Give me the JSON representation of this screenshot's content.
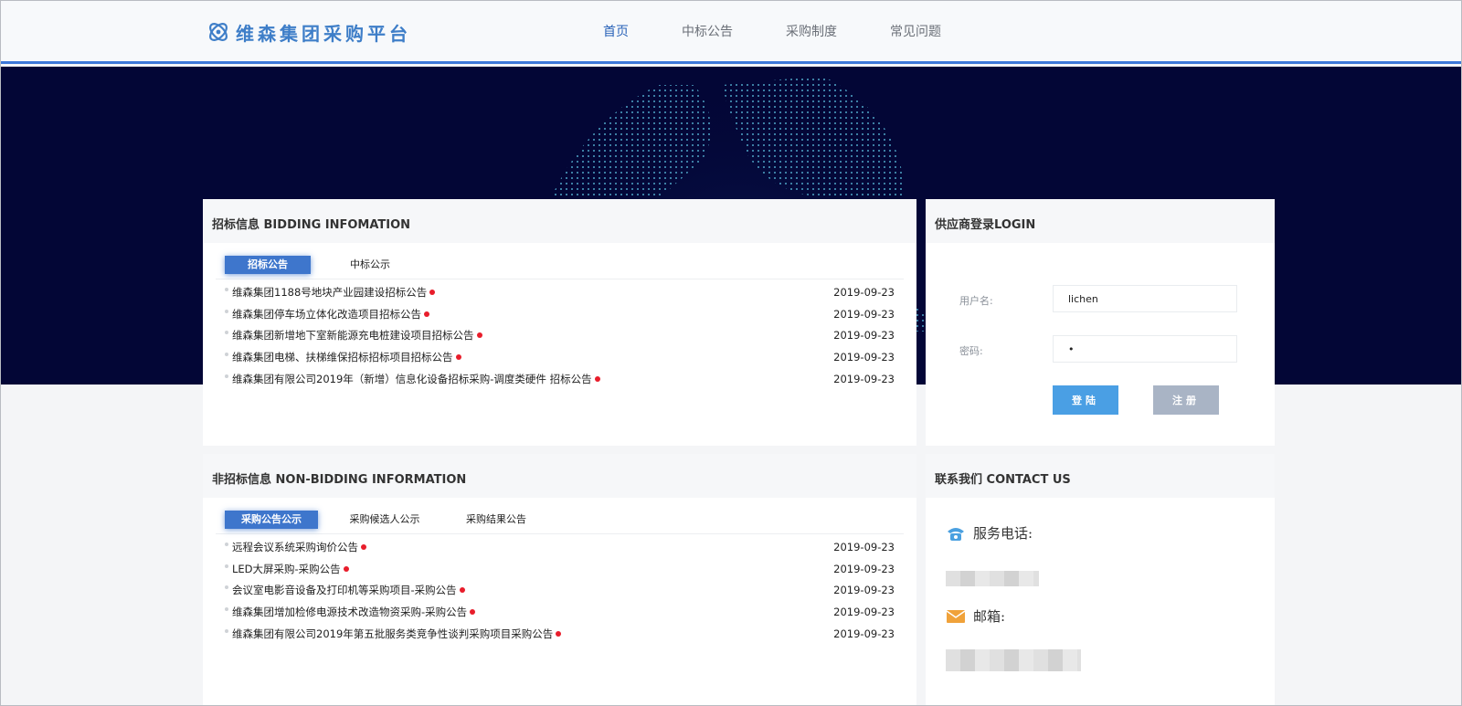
{
  "header": {
    "logo_text": "维森集团采购平台",
    "nav": [
      {
        "label": "首页",
        "active": true
      },
      {
        "label": "中标公告",
        "active": false
      },
      {
        "label": "采购制度",
        "active": false
      },
      {
        "label": "常见问题",
        "active": false
      }
    ]
  },
  "bidding": {
    "heading": "招标信息 BIDDING INFOMATION",
    "tabs": [
      "招标公告",
      "中标公示"
    ],
    "active_tab": 0,
    "items": [
      {
        "title": "维森集团1188号地块产业园建设招标公告",
        "date": "2019-09-23"
      },
      {
        "title": "维森集团停车场立体化改造项目招标公告",
        "date": "2019-09-23"
      },
      {
        "title": "维森集团新增地下室新能源充电桩建设项目招标公告",
        "date": "2019-09-23"
      },
      {
        "title": "维森集团电梯、扶梯维保招标招标项目招标公告",
        "date": "2019-09-23"
      },
      {
        "title": "维森集团有限公司2019年（新增）信息化设备招标采购-调度类硬件 招标公告",
        "date": "2019-09-23"
      }
    ]
  },
  "nonbidding": {
    "heading": "非招标信息 NON-BIDDING INFORMATION",
    "tabs": [
      "采购公告公示",
      "采购候选人公示",
      "采购结果公告"
    ],
    "active_tab": 0,
    "items": [
      {
        "title": "远程会议系统采购询价公告",
        "date": "2019-09-23"
      },
      {
        "title": "LED大屏采购-采购公告",
        "date": "2019-09-23"
      },
      {
        "title": "会议室电影音设备及打印机等采购项目-采购公告",
        "date": "2019-09-23"
      },
      {
        "title": "维森集团增加检修电源技术改造物资采购-采购公告",
        "date": "2019-09-23"
      },
      {
        "title": "维森集团有限公司2019年第五批服务类竞争性谈判采购项目采购公告",
        "date": "2019-09-23"
      }
    ]
  },
  "login": {
    "heading": "供应商登录LOGIN",
    "username_label": "用户名:",
    "username_value": "lichen",
    "password_label": "密码:",
    "password_value": "•",
    "login_button": "登陆",
    "register_button": "注册"
  },
  "contact": {
    "heading": "联系我们 CONTACT US",
    "phone_label": "服务电话:",
    "email_label": "邮箱:"
  },
  "colors": {
    "accent": "#3e76cc",
    "hero_bg": "#030636",
    "new_dot": "#e81d2b"
  }
}
